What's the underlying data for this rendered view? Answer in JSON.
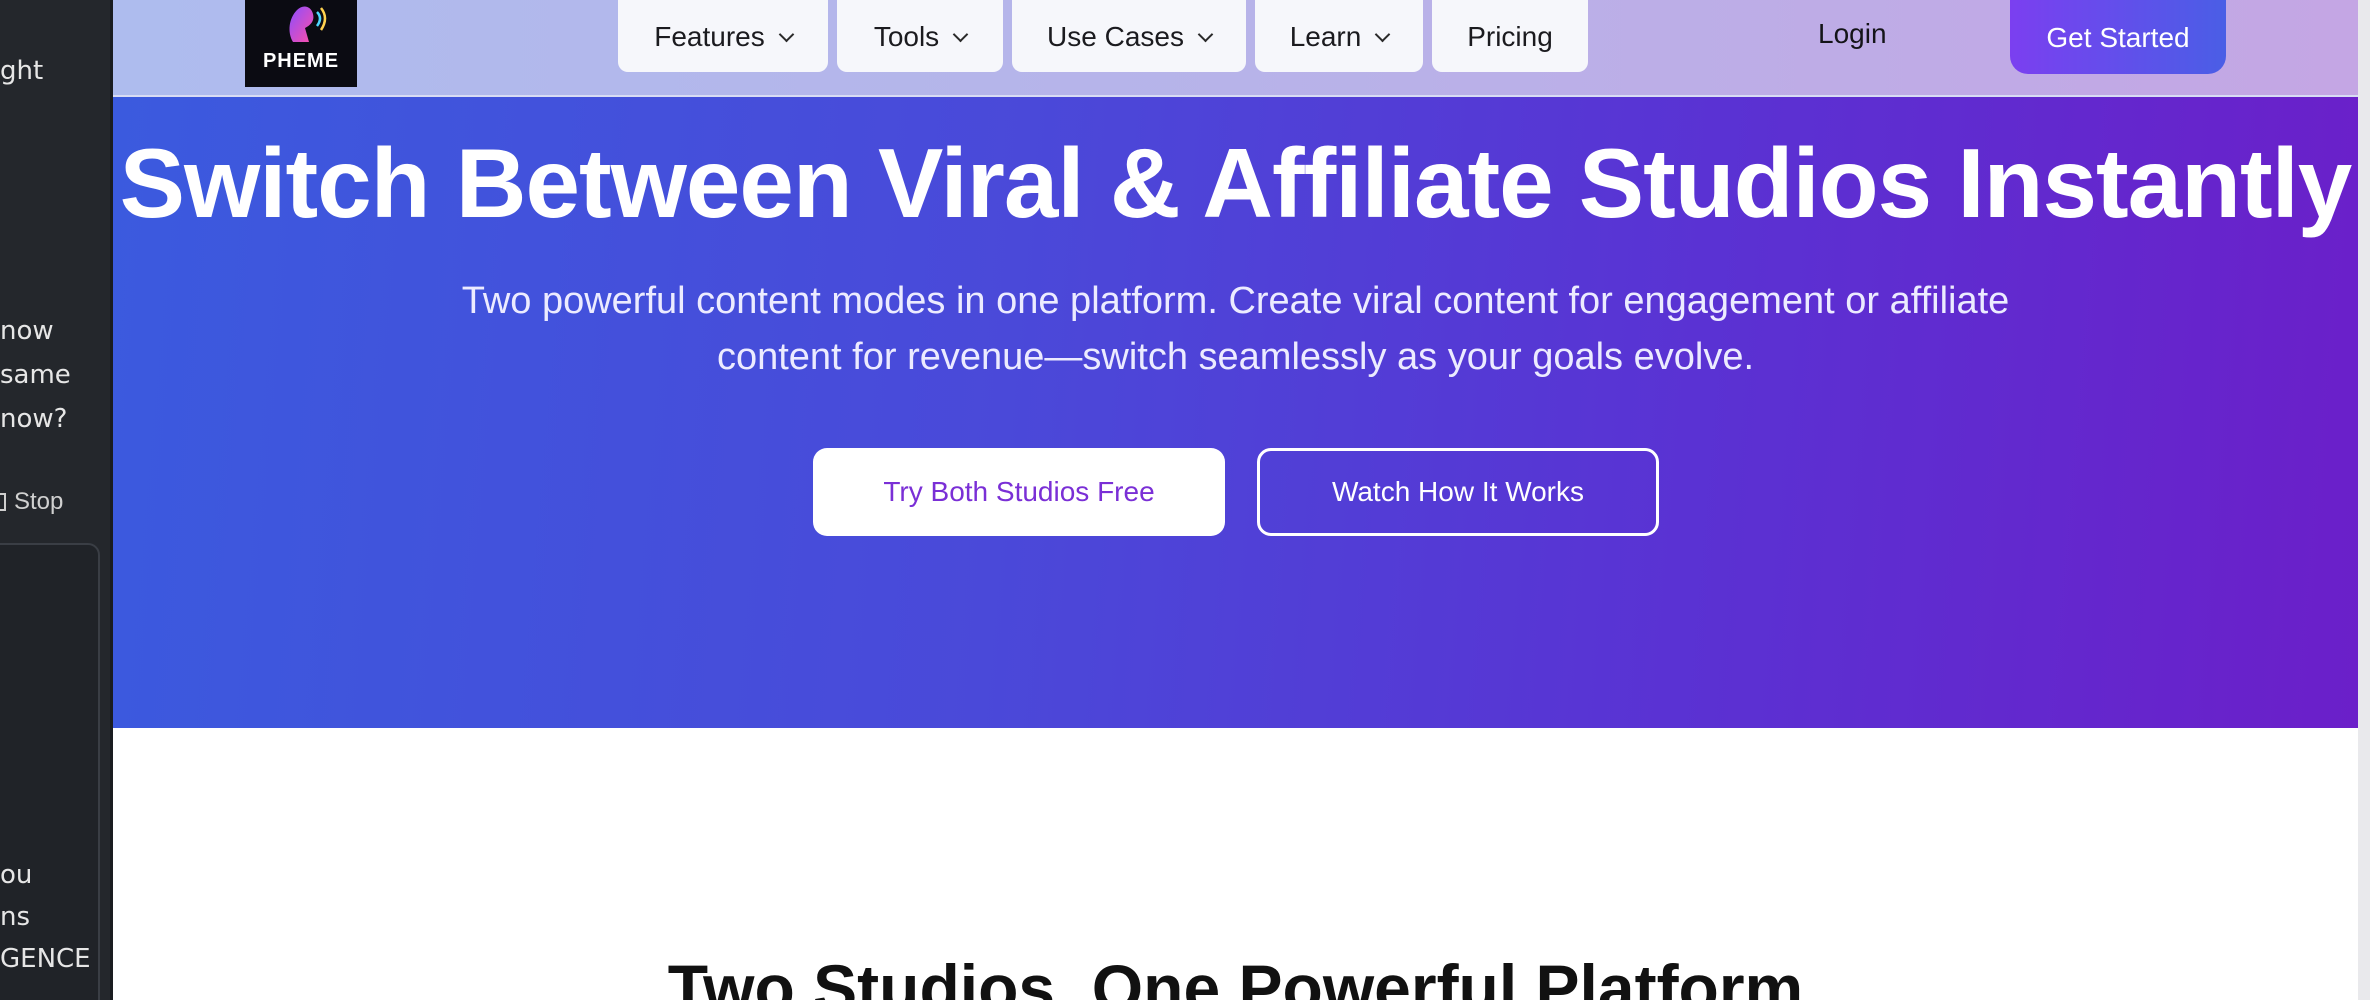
{
  "side_panel": {
    "lines": [
      "ght",
      "now",
      "same",
      "now?",
      "ou",
      "ns",
      "GENCE"
    ],
    "stop_label": "Stop"
  },
  "nav": {
    "logo_text": "PHEME",
    "items": [
      {
        "label": "Features",
        "has_dropdown": true
      },
      {
        "label": "Tools",
        "has_dropdown": true
      },
      {
        "label": "Use Cases",
        "has_dropdown": true
      },
      {
        "label": "Learn",
        "has_dropdown": true
      },
      {
        "label": "Pricing",
        "has_dropdown": false
      }
    ],
    "login_label": "Login",
    "cta_label": "Get Started"
  },
  "hero": {
    "title": "Switch Between Viral & Affiliate Studios Instantly",
    "subtitle": "Two powerful content modes in one platform. Create viral content for engagement or affiliate content for revenue—switch seamlessly as your goals evolve.",
    "primary_button": "Try Both Studios Free",
    "secondary_button": "Watch How It Works"
  },
  "section": {
    "title": "Two Studios. One Powerful Platform"
  },
  "colors": {
    "hero_start": "#3b5ade",
    "hero_end": "#6b1fc9",
    "accent_purple": "#7a2fd6"
  }
}
